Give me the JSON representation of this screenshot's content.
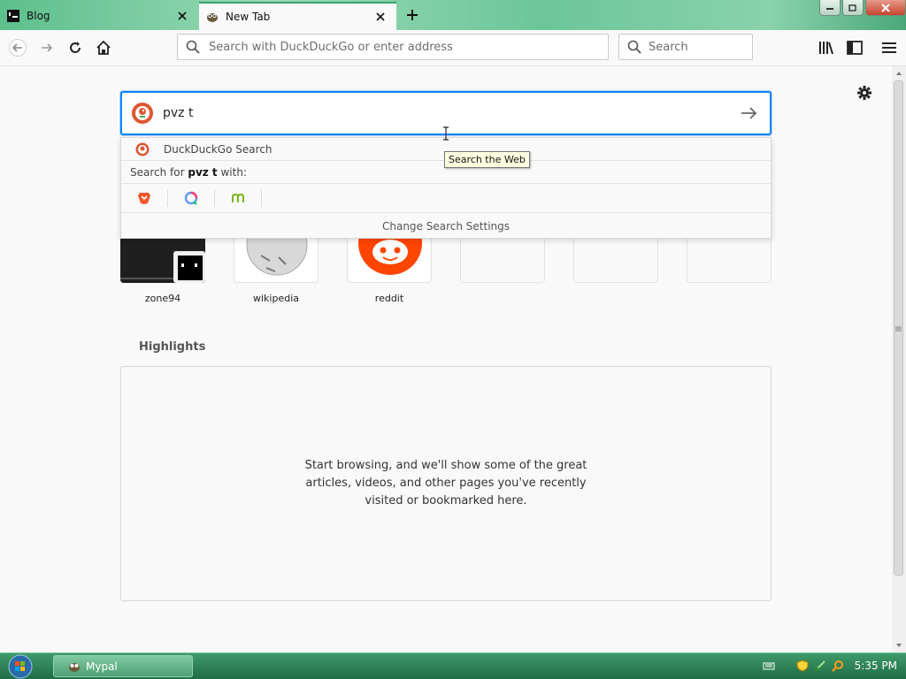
{
  "tabs": [
    {
      "label": "Blog",
      "active": false
    },
    {
      "label": "New Tab",
      "active": true
    }
  ],
  "toolbar": {
    "url_placeholder": "Search with DuckDuckGo or enter address",
    "search_placeholder": "Search"
  },
  "ddg_search": {
    "query": "pvz t"
  },
  "dropdown": {
    "engine_row_label": "DuckDuckGo Search",
    "search_for_prefix": "Search for ",
    "search_for_query": "pvz t",
    "search_for_suffix": " with:",
    "engines": [
      "brave-icon",
      "qwant-icon",
      "mojeek-icon"
    ],
    "settings_label": "Change Search Settings"
  },
  "tooltip": "Search the Web",
  "top_sites": [
    {
      "label": "zone94"
    },
    {
      "label": "wikipedia"
    },
    {
      "label": "reddit"
    },
    {
      "label": ""
    },
    {
      "label": ""
    },
    {
      "label": ""
    }
  ],
  "highlights": {
    "title": "Highlights",
    "empty_text": "Start browsing, and we'll show some of the great articles, videos, and other pages you've recently visited or bookmarked here."
  },
  "taskbar": {
    "app_label": "Mypal",
    "clock": "5:35 PM"
  },
  "colors": {
    "accent": "#0a84ff",
    "reddit": "#ff4500",
    "taskbar": "#2a7d52"
  }
}
